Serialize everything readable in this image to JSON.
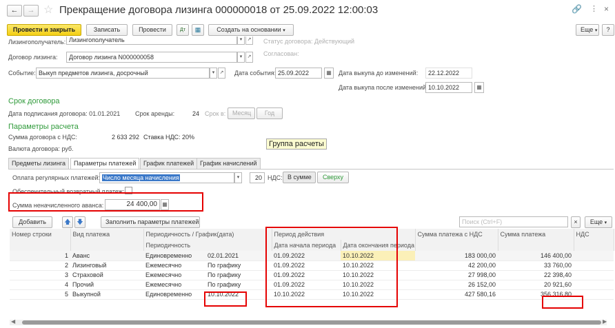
{
  "window": {
    "title": "Прекращение договора лизинга 000000018 от 25.09.2022 12:00:03"
  },
  "toolbar": {
    "post_close": "Провести и закрыть",
    "write": "Записать",
    "post": "Провести",
    "create_based": "Создать на основании",
    "more": "Еще",
    "help": "?"
  },
  "form": {
    "lessee_label": "Лизингополучатель:",
    "lessee_value": "Лизингополучатель",
    "status_text": "Статус договора: Действующий",
    "contract_label": "Договор лизинга:",
    "contract_value": "Договор лизинга N000000058",
    "agreed_text": "Согласован:",
    "event_label": "Событие:",
    "event_value": "Выкуп предметов лизинга, досрочный",
    "event_date_label": "Дата события:",
    "event_date": "25.09.2022",
    "buyout_before_label": "Дата выкупа до изменений:",
    "buyout_before": "22.12.2022",
    "buyout_after_label": "Дата выкупа после изменений:",
    "buyout_after": "10.10.2022"
  },
  "term": {
    "header": "Срок договора",
    "sign_date": "Дата подписания договора: 01.01.2021",
    "lease_term_label": "Срок аренды:",
    "lease_term_value": "24",
    "term_in_label": "Срок в:",
    "month": "Месяц",
    "year": "Год"
  },
  "calc": {
    "header": "Параметры расчета",
    "sum_label": "Сумма договора с НДС:",
    "sum_value": "2 633 292",
    "vat_rate": "Ставка НДС: 20%",
    "currency": "Валюта договора: руб.",
    "tooltip": "Группа расчеты"
  },
  "tabs": [
    "Предметы лизинга",
    "Параметры платежей",
    "График платежей",
    "График начислений"
  ],
  "payments": {
    "regular_label": "Оплата регулярных платежей:",
    "regular_value": "Число месяца начисления",
    "day_value": "20",
    "vat_label": "НДС:",
    "vat_in_sum": "В сумме",
    "vat_above": "Сверху",
    "security_label": "Обеспечительный возвратный платеж:",
    "advance_label": "Сумма неначисленного аванса:",
    "advance_value": "24 400,00",
    "add": "Добавить",
    "fill": "Заполнить параметры платежей",
    "search_placeholder": "Поиск (Ctrl+F)",
    "more": "Еще"
  },
  "table": {
    "headers": {
      "row_no": "Номер строки",
      "type": "Вид платежа",
      "periodicity_sched": "Периодичность / График(дата)",
      "periodicity": "Периодичность",
      "period": "Период действия",
      "start": "Дата начала периода",
      "end": "Дата окончания периода",
      "sum_vat": "Сумма платежа с НДС",
      "sum": "Сумма платежа",
      "vat": "НДС"
    },
    "rows": [
      {
        "n": "1",
        "type": "Аванс",
        "per": "Единовременно",
        "sched": "02.01.2021",
        "start": "01.09.2022",
        "end": "10.10.2022",
        "sum_vat": "183 000,00",
        "sum": "146 400,00"
      },
      {
        "n": "2",
        "type": "Лизинговый",
        "per": "Ежемесячно",
        "sched": "По графику",
        "start": "01.09.2022",
        "end": "10.10.2022",
        "sum_vat": "42 200,00",
        "sum": "33 760,00"
      },
      {
        "n": "3",
        "type": "Страховой",
        "per": "Ежемесячно",
        "sched": "По графику",
        "start": "01.09.2022",
        "end": "10.10.2022",
        "sum_vat": "27 998,00",
        "sum": "22 398,40"
      },
      {
        "n": "4",
        "type": "Прочий",
        "per": "Ежемесячно",
        "sched": "По графику",
        "start": "01.09.2022",
        "end": "10.10.2022",
        "sum_vat": "26 152,00",
        "sum": "20 921,60"
      },
      {
        "n": "5",
        "type": "Выкупной",
        "per": "Единовременно",
        "sched": "10.10.2022",
        "start": "10.10.2022",
        "end": "10.10.2022",
        "sum_vat": "427 580,16",
        "sum": "356 316,80"
      }
    ]
  },
  "colors": {
    "accent_yellow": "#f4cf15",
    "section_green": "#2f9a3a",
    "highlight_red": "#e50000"
  }
}
